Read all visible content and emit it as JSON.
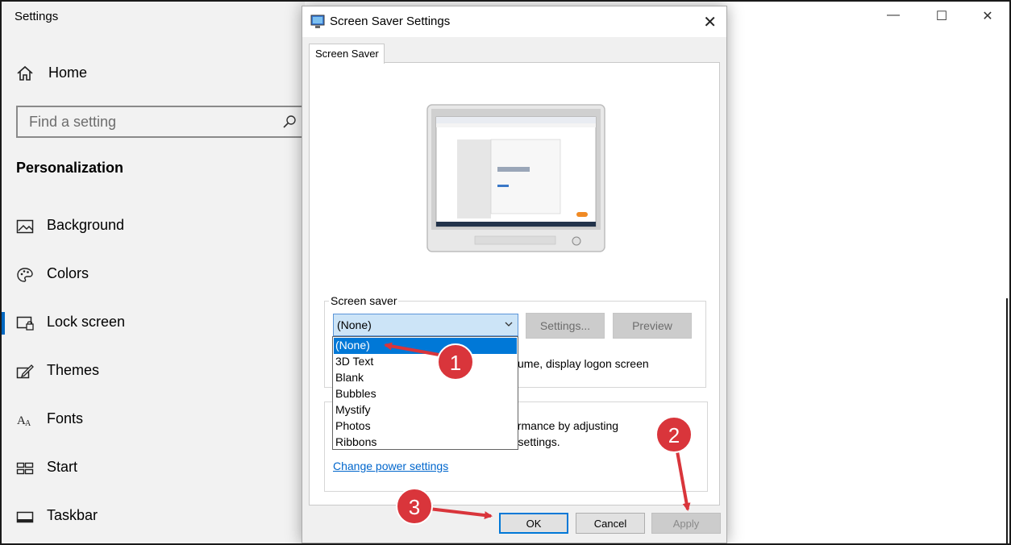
{
  "settings_window": {
    "title": "Settings",
    "controls": {
      "minimize_icon": "minimize-icon",
      "maximize_icon": "maximize-icon",
      "close_icon": "close-icon"
    },
    "sidebar": {
      "home_label": "Home",
      "search_placeholder": "Find a setting",
      "section_title": "Personalization",
      "items": [
        {
          "label": "Background",
          "icon": "image-icon"
        },
        {
          "label": "Colors",
          "icon": "palette-icon"
        },
        {
          "label": "Lock screen",
          "icon": "lock-screen-icon",
          "active": true
        },
        {
          "label": "Themes",
          "icon": "themes-icon"
        },
        {
          "label": "Fonts",
          "icon": "fonts-icon"
        },
        {
          "label": "Start",
          "icon": "start-icon"
        },
        {
          "label": "Taskbar",
          "icon": "taskbar-icon"
        }
      ]
    }
  },
  "dialog": {
    "title": "Screen Saver Settings",
    "tab": "Screen Saver",
    "screen_saver_group": {
      "label": "Screen saver",
      "selected": "(None)",
      "settings_button": "Settings...",
      "preview_button": "Preview",
      "resume_text": "ume, display logon screen"
    },
    "power_group": {
      "text_line1": "ormance by adjusting",
      "text_line2": "r settings.",
      "link": "Change power settings"
    },
    "dropdown_options": [
      "(None)",
      "3D Text",
      "Blank",
      "Bubbles",
      "Mystify",
      "Photos",
      "Ribbons"
    ],
    "buttons": {
      "ok": "OK",
      "cancel": "Cancel",
      "apply": "Apply"
    }
  },
  "annotations": [
    "1",
    "2",
    "3"
  ],
  "colors": {
    "accent": "#0078d7",
    "annotation_red": "#d9353b",
    "selection_blue": "#cce4f7"
  }
}
